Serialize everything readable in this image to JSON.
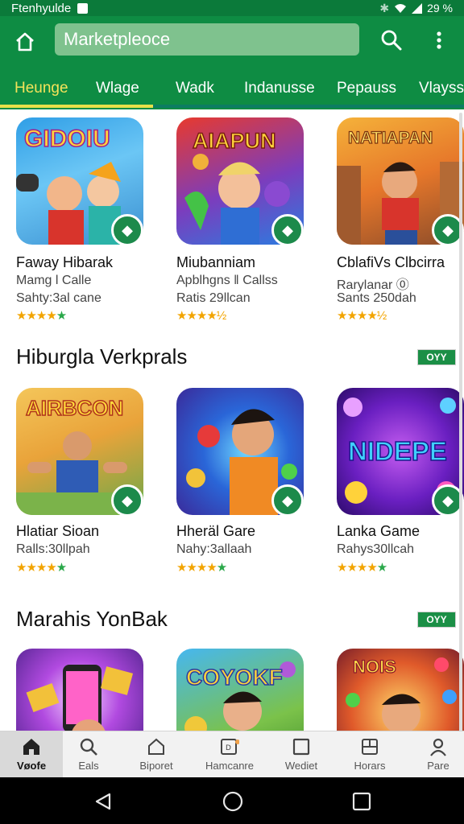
{
  "status": {
    "left_text": "Ftenhyulde",
    "battery": "29 %"
  },
  "search": {
    "placeholder": "Marketpleoce"
  },
  "tabs": [
    "Heunge",
    "Wlage",
    "Wadk",
    "Indanusse",
    "Pepauss",
    "Vlayss"
  ],
  "rows": [
    {
      "cards": [
        {
          "banner": "GIDOIU",
          "title": "Faway Hibarak",
          "line1": "Mamg l Calle",
          "line2": "Sahty:3al cane",
          "rating": 4
        },
        {
          "banner": "AIAPUN",
          "title": "Miubanniam",
          "line1": "Apblhgns ‖ Callss",
          "line2": "Ratis 29llcan",
          "rating": 4.5
        },
        {
          "banner": "NATIAPAN",
          "title": "CblafiVs Clbcirra",
          "line1": "Rarylanar ⓪",
          "line2": "Sants 250dah",
          "rating": 4.5
        }
      ]
    },
    {
      "section_title": "Hiburgla Verkprals",
      "section_badge": "OYY",
      "cards": [
        {
          "banner": "AIRBCON",
          "title": "Hlatiar Sioan",
          "line1": "Ralls:30llpah",
          "line2": "",
          "rating": 4
        },
        {
          "banner": "",
          "title": "Hheräl Gare",
          "line1": "Nahy:3allaah",
          "line2": "",
          "rating": 4
        },
        {
          "banner": "NIDEPE",
          "title": "Lanka Game",
          "line1": "Rahys30llcah",
          "line2": "",
          "rating": 4
        }
      ]
    },
    {
      "section_title": "Marahis YonBak",
      "section_badge": "OYY",
      "cards": [
        {
          "banner": "",
          "title": "",
          "line1": "",
          "line2": "",
          "rating": 0
        },
        {
          "banner": "COYOKF",
          "title": "",
          "line1": "",
          "line2": "",
          "rating": 0
        },
        {
          "banner": "NOIS",
          "title": "",
          "line1": "",
          "line2": "",
          "rating": 0
        }
      ]
    }
  ],
  "bottom_nav": [
    "Vøofe",
    "Eals",
    "Biporet",
    "Hamcanre",
    "Wediet",
    "Horars",
    "Pare"
  ],
  "colors": {
    "primary": "#0e8c43",
    "accent_tab": "#f4e35a",
    "star": "#f2a400"
  }
}
